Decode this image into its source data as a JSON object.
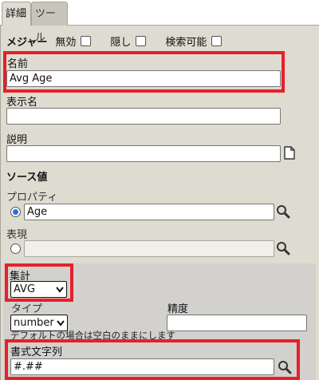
{
  "tabs": [
    {
      "label": "詳細",
      "active": true
    },
    {
      "label": "ツール",
      "active": false
    }
  ],
  "measure_row": {
    "measure_label": "メジャー",
    "disabled_label": "無効",
    "hidden_label": "隠し",
    "searchable_label": "検索可能"
  },
  "name": {
    "label": "名前",
    "value": "Avg Age"
  },
  "display_name": {
    "label": "表示名",
    "value": ""
  },
  "description": {
    "label": "説明",
    "value": ""
  },
  "source_value": {
    "heading": "ソース値",
    "property_label": "プロパティ",
    "property_value": "Age",
    "expression_label": "表現",
    "expression_value": ""
  },
  "aggregate": {
    "label": "集計",
    "selected": "AVG"
  },
  "type": {
    "label": "タイプ",
    "selected": "number",
    "hint": "デフォルトの場合は空白のままにします"
  },
  "precision": {
    "label": "精度",
    "value": ""
  },
  "format_string": {
    "label": "書式文字列",
    "value": "#.##"
  },
  "colors": {
    "highlight": "#e5202a",
    "radio_selected": "#1a73e8"
  }
}
